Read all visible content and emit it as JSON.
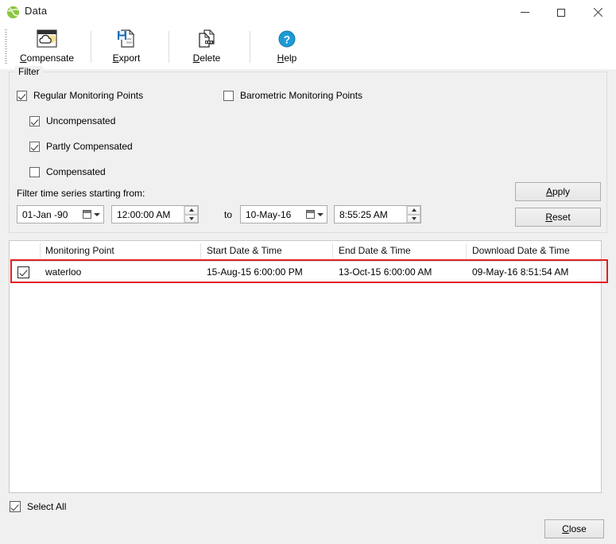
{
  "window": {
    "title": "Data",
    "app_icon": "green-globe-icon",
    "controls": {
      "minimize": "minimize-icon",
      "maximize": "maximize-icon",
      "close": "close-icon"
    }
  },
  "toolbar": {
    "items": [
      {
        "label": "Compensate",
        "accel": "C",
        "icon": "compensate-cloud-icon"
      },
      {
        "label": "Export",
        "accel": "E",
        "icon": "export-save-icon"
      },
      {
        "label": "Delete",
        "accel": "D",
        "icon": "delete-document-icon"
      },
      {
        "label": "Help",
        "accel": "H",
        "icon": "help-question-icon"
      }
    ]
  },
  "filter": {
    "legend": "Filter",
    "checkboxes": [
      {
        "label": "Regular Monitoring Points",
        "checked": true
      },
      {
        "label": "Barometric Monitoring Points",
        "checked": false
      },
      {
        "label": "Uncompensated",
        "checked": true
      },
      {
        "label": "Partly Compensated",
        "checked": true
      },
      {
        "label": "Compensated",
        "checked": false
      }
    ],
    "time_label": "Filter time series starting from:",
    "start_date": "01-Jan -90",
    "start_time": "12:00:00 AM",
    "to_label": "to",
    "end_date": "10-May-16",
    "end_time": "8:55:25 AM",
    "apply_label": "Apply",
    "reset_label": "Reset"
  },
  "list": {
    "columns": [
      "Monitoring Point",
      "Start Date & Time",
      "End Date & Time",
      "Download Date & Time"
    ],
    "rows": [
      {
        "checked": true,
        "monitoring_point": "waterloo",
        "start": "15-Aug-15 6:00:00 PM",
        "end": "13-Oct-15 6:00:00 AM",
        "download": "09-May-16 8:51:54 AM"
      }
    ],
    "highlight_color": "#e02020"
  },
  "footer": {
    "select_all": "Select All",
    "close_label": "Close"
  }
}
